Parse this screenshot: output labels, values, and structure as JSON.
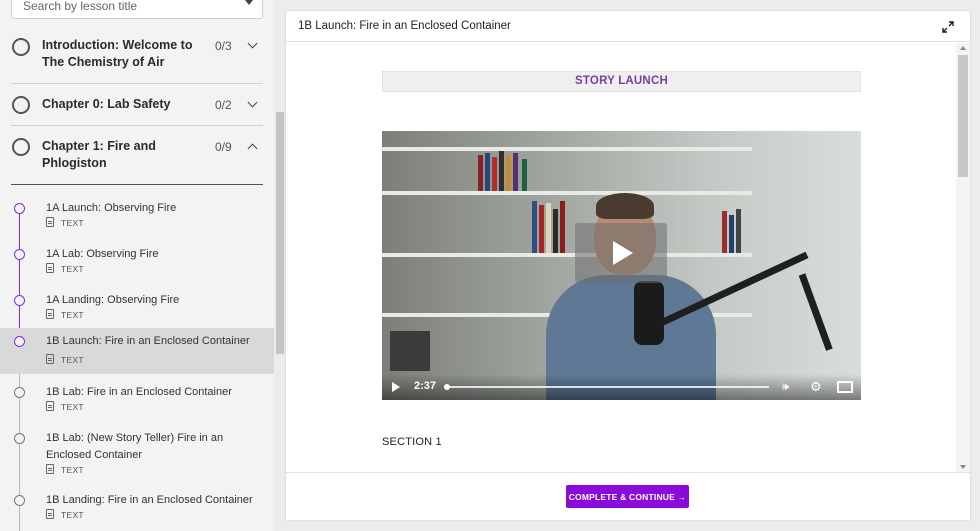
{
  "search": {
    "placeholder": "Search by lesson title"
  },
  "chapters": [
    {
      "title": "Introduction: Welcome to The Chemistry of Air",
      "progress": "0/3",
      "expanded": false
    },
    {
      "title": "Chapter 0: Lab Safety",
      "progress": "0/2",
      "expanded": false
    },
    {
      "title": "Chapter 1: Fire and Phlogiston",
      "progress": "0/9",
      "expanded": true
    }
  ],
  "lessons": [
    {
      "title": "1A Launch: Observing Fire",
      "type": "TEXT",
      "state": "done"
    },
    {
      "title": "1A Lab: Observing Fire",
      "type": "TEXT",
      "state": "done"
    },
    {
      "title": "1A Landing: Observing Fire",
      "type": "TEXT",
      "state": "done"
    },
    {
      "title": "1B Launch: Fire in an Enclosed Container",
      "type": "TEXT",
      "state": "active"
    },
    {
      "title": "1B Lab: Fire in an Enclosed Container",
      "type": "TEXT",
      "state": "todo"
    },
    {
      "title": "1B Lab: (New Story Teller) Fire in an Enclosed Container",
      "type": "TEXT",
      "state": "todo"
    },
    {
      "title": "1B Landing: Fire in an Enclosed Container",
      "type": "TEXT",
      "state": "todo"
    }
  ],
  "main": {
    "title": "1B Launch: Fire in an Enclosed Container",
    "banner": "STORY LAUNCH",
    "video": {
      "time": "2:37",
      "progress": 0.0
    },
    "section": "SECTION 1",
    "complete_label": "COMPLETE & CONTINUE →"
  },
  "colors": {
    "accent": "#8a0bd9",
    "banner_text": "#7b3fa0",
    "timeline": "#8a2be2"
  }
}
